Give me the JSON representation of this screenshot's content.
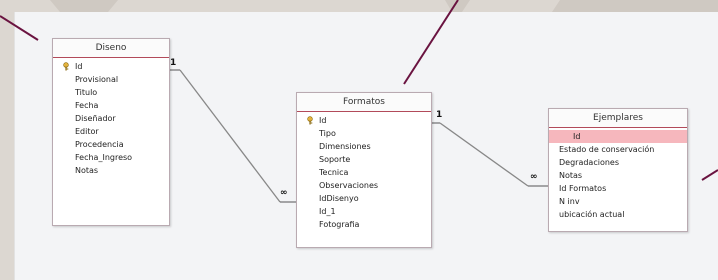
{
  "tables": {
    "diseno": {
      "title": "Diseno",
      "fields": [
        "Id",
        "Provisional",
        "Titulo",
        "Fecha",
        "Diseñador",
        "Editor",
        "Procedencia",
        "Fecha_Ingreso",
        "Notas"
      ]
    },
    "formatos": {
      "title": "Formatos",
      "fields": [
        "Id",
        "Tipo",
        "Dimensiones",
        "Soporte",
        "Tecnica",
        "Observaciones",
        "IdDisenyo",
        "Id_1",
        "Fotografia"
      ]
    },
    "ejemplares": {
      "title": "Ejemplares",
      "fields": [
        "Id",
        "Estado de conservación",
        "Degradaciones",
        "Notas",
        "Id Formatos",
        "N inv",
        "ubicación actual"
      ]
    }
  },
  "relationships": {
    "diseno_formatos": {
      "one": "1",
      "many": "∞"
    },
    "formatos_ejemplares": {
      "one": "1",
      "many": "∞"
    }
  },
  "icons": {
    "primary_key": "key-icon"
  },
  "colors": {
    "pointer": "#6a1340",
    "header_border": "#b24a5a",
    "selected_row": "#f6b7bd"
  }
}
